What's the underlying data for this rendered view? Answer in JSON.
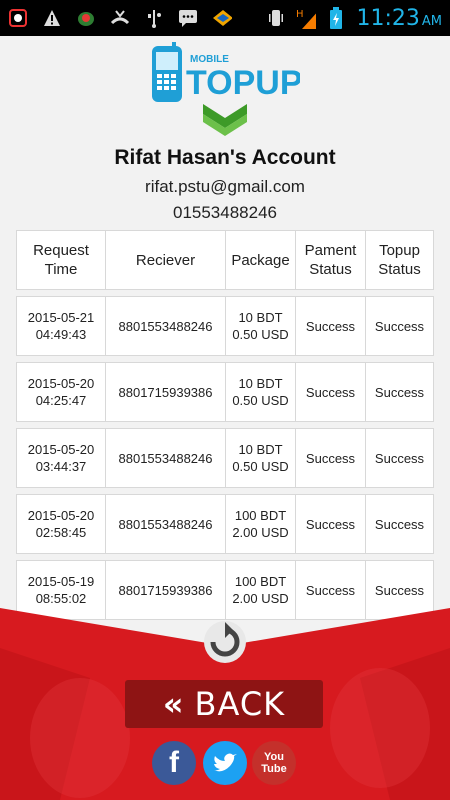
{
  "status_bar": {
    "time": "11:23",
    "ampm": "AM",
    "icons": [
      "app-icon",
      "warning-icon",
      "bug-icon",
      "missed-call-icon",
      "usb-icon",
      "message-icon",
      "sun-icon",
      "vibrate-icon",
      "signal-icon",
      "battery-icon"
    ]
  },
  "logo": {
    "small": "MOBILE",
    "big": "TOPUP"
  },
  "account": {
    "name": "Rifat Hasan's Account",
    "email": "rifat.pstu@gmail.com",
    "phone": "01553488246"
  },
  "table": {
    "headers": [
      "Request Time",
      "Reciever",
      "Package",
      "Pament Status",
      "Topup Status"
    ],
    "rows": [
      {
        "date": "2015-05-21",
        "time": "04:49:43",
        "receiver": "8801553488246",
        "pkg1": "10 BDT",
        "pkg2": "0.50 USD",
        "pay": "Success",
        "topup": "Success"
      },
      {
        "date": "2015-05-20",
        "time": "04:25:47",
        "receiver": "8801715939386",
        "pkg1": "10 BDT",
        "pkg2": "0.50 USD",
        "pay": "Success",
        "topup": "Success"
      },
      {
        "date": "2015-05-20",
        "time": "03:44:37",
        "receiver": "8801553488246",
        "pkg1": "10 BDT",
        "pkg2": "0.50 USD",
        "pay": "Success",
        "topup": "Success"
      },
      {
        "date": "2015-05-20",
        "time": "02:58:45",
        "receiver": "8801553488246",
        "pkg1": "100 BDT",
        "pkg2": "2.00 USD",
        "pay": "Success",
        "topup": "Success"
      },
      {
        "date": "2015-05-19",
        "time": "08:55:02",
        "receiver": "8801715939386",
        "pkg1": "100 BDT",
        "pkg2": "2.00 USD",
        "pay": "Success",
        "topup": "Success"
      }
    ]
  },
  "back_label": "BACK",
  "social": {
    "facebook": "f",
    "youtube_top": "You",
    "youtube_bottom": "Tube"
  },
  "colors": {
    "brand_blue": "#1f9fd6",
    "green": "#4caf2c",
    "red": "#d71a1f",
    "back_bg": "#8e1414"
  }
}
